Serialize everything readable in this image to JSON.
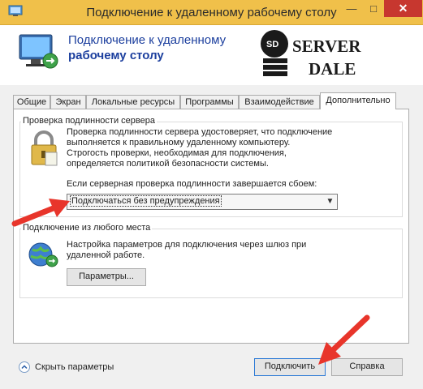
{
  "window": {
    "title": "Подключение к удаленному рабочему столу",
    "minimize_glyph": "—",
    "maximize_glyph": "□",
    "close_glyph": "✕"
  },
  "header": {
    "line1": "Подключение к удаленному",
    "line2": "рабочему столу",
    "logo": {
      "sd": "SD",
      "word1": "SERVER",
      "word2": "DALE"
    }
  },
  "tabs": [
    {
      "label": "Общие"
    },
    {
      "label": "Экран"
    },
    {
      "label": "Локальные ресурсы"
    },
    {
      "label": "Программы"
    },
    {
      "label": "Взаимодействие"
    },
    {
      "label": "Дополнительно",
      "active": true
    }
  ],
  "auth_group": {
    "title": "Проверка подлинности сервера",
    "description_lines": [
      "Проверка подлинности сервера удостоверяет, что подключение",
      "выполняется к правильному удаленному компьютеру.",
      "Строгость проверки, необходимая для подключения,",
      "определяется политикой безопасности системы."
    ],
    "select_label": "Если серверная проверка подлинности завершается сбоем:",
    "select_value": "Подключаться без предупреждения"
  },
  "anywhere_group": {
    "title": "Подключение из любого места",
    "description_lines": [
      "Настройка параметров для подключения через шлюз при",
      "удаленной работе."
    ],
    "params_button": "Параметры..."
  },
  "footer": {
    "hide_params": "Скрыть параметры",
    "connect_button": "Подключить",
    "help_button": "Справка"
  },
  "colors": {
    "titlebar": "#f0c04a",
    "heading": "#1c3f9e",
    "close": "#c7372f",
    "annotation_arrow": "#e8352b"
  },
  "icons": [
    "remote-desktop-icon",
    "lock-icon",
    "globe-network-icon",
    "chevron-up-icon",
    "dropdown-arrow-icon"
  ]
}
